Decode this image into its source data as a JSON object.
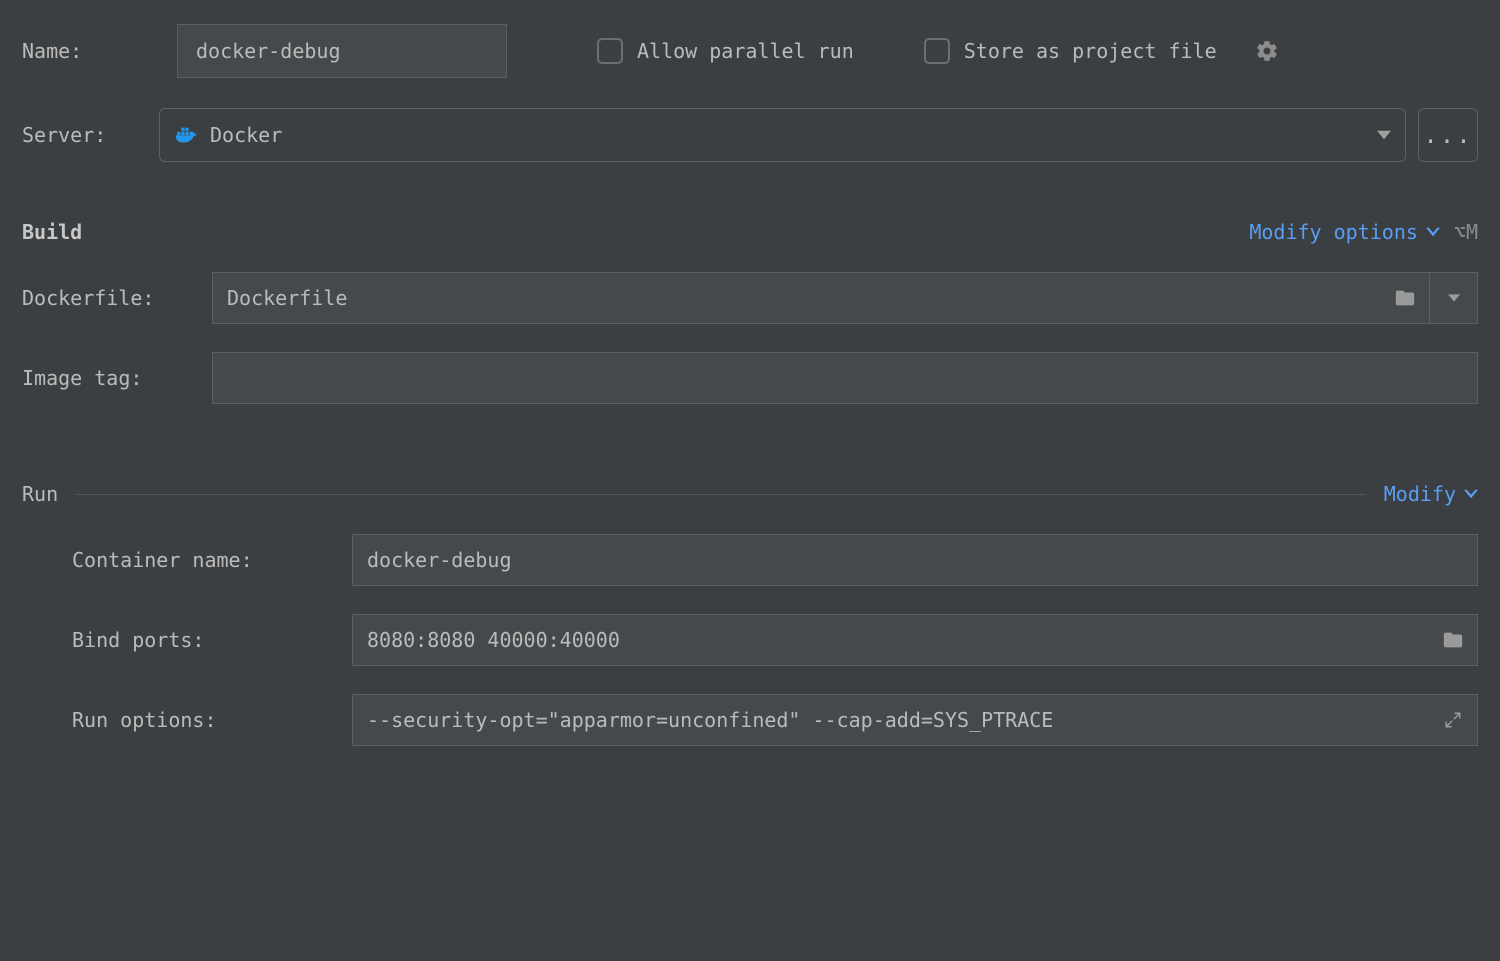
{
  "name": {
    "label": "Name:",
    "value": "docker-debug"
  },
  "allow_parallel": {
    "label": "Allow parallel run",
    "checked": false
  },
  "store_project": {
    "label": "Store as project file",
    "checked": false
  },
  "server": {
    "label": "Server:",
    "value": "Docker"
  },
  "build": {
    "title": "Build",
    "modify_label": "Modify options",
    "shortcut": "⌥M",
    "dockerfile": {
      "label": "Dockerfile:",
      "value": "Dockerfile"
    },
    "image_tag": {
      "label": "Image tag:",
      "value": ""
    }
  },
  "run": {
    "title": "Run",
    "modify_label": "Modify",
    "container_name": {
      "label": "Container name:",
      "value": "docker-debug"
    },
    "bind_ports": {
      "label": "Bind ports:",
      "value": "8080:8080 40000:40000"
    },
    "run_options": {
      "label": "Run options:",
      "value": "--security-opt=\"apparmor=unconfined\" --cap-add=SYS_PTRACE"
    }
  },
  "ellipsis": "..."
}
